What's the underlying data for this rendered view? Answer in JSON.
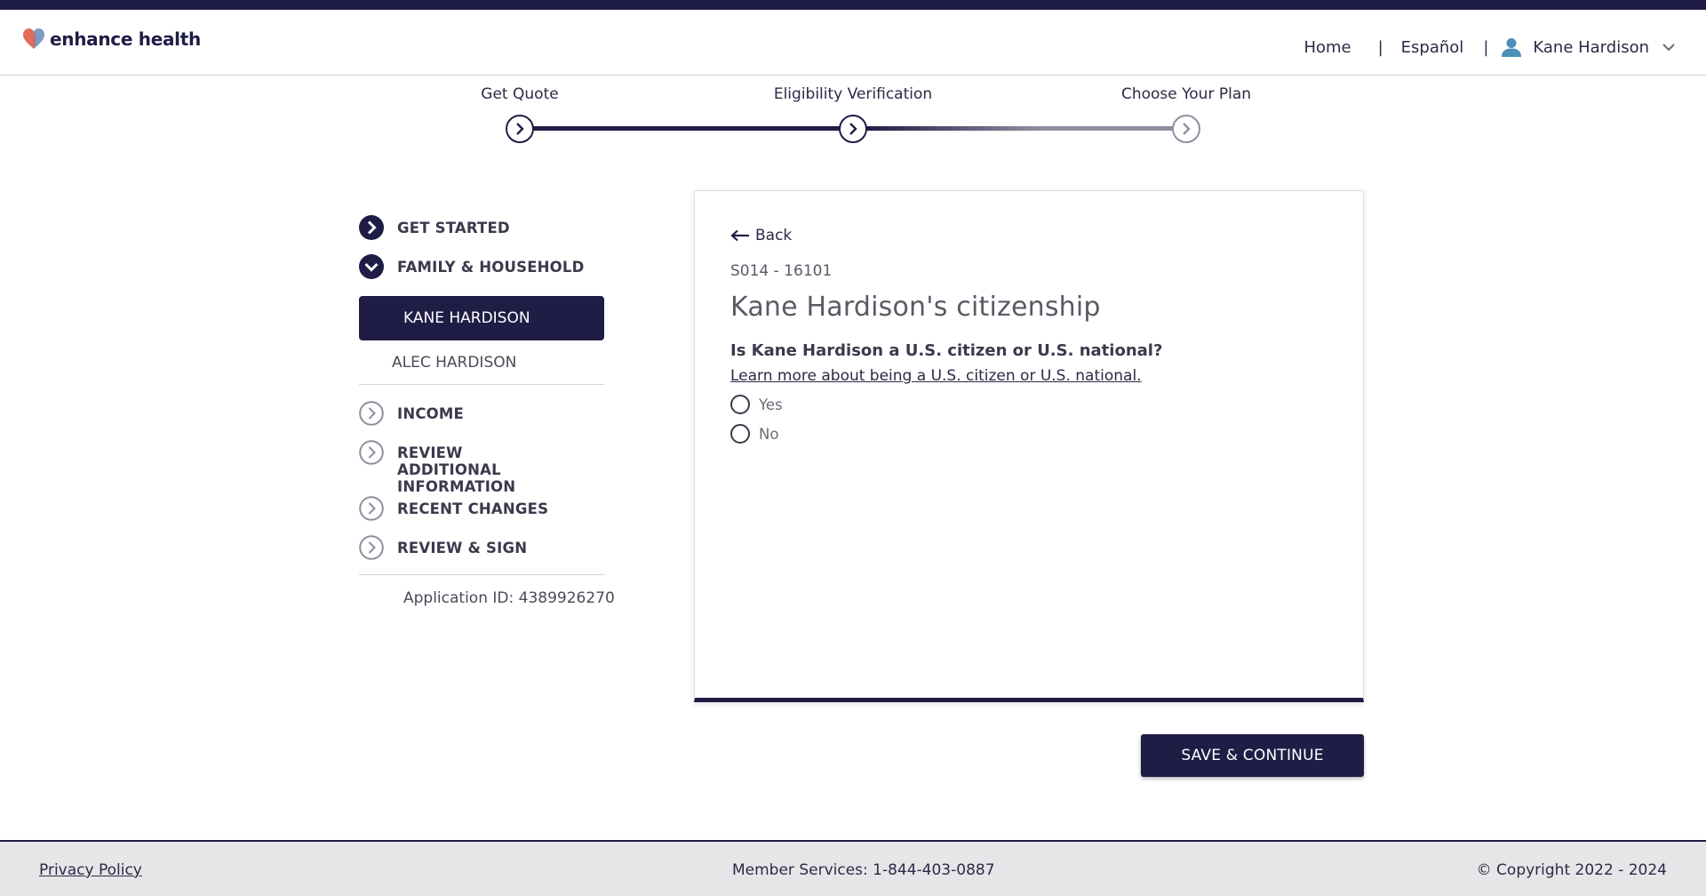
{
  "header": {
    "logo_text": "enhance health",
    "nav": {
      "home": "Home",
      "separator": "|",
      "language": "Español",
      "user_name": "Kane Hardison"
    }
  },
  "progress": {
    "steps": [
      {
        "label": "Get Quote",
        "status": "complete"
      },
      {
        "label": "Eligibility Verification",
        "status": "current"
      },
      {
        "label": "Choose Your Plan",
        "status": "upcoming"
      }
    ]
  },
  "sidebar": {
    "items": [
      {
        "label": "GET STARTED",
        "icon": "chevron-right-filled-icon"
      },
      {
        "label": "FAMILY & HOUSEHOLD",
        "icon": "chevron-down-filled-icon"
      }
    ],
    "members": [
      {
        "label": "KANE HARDISON",
        "active": true
      },
      {
        "label": "ALEC HARDISON",
        "active": false
      }
    ],
    "items2": [
      {
        "label": "INCOME"
      },
      {
        "label": "REVIEW ADDITIONAL INFORMATION"
      },
      {
        "label": "RECENT CHANGES"
      },
      {
        "label": "REVIEW & SIGN"
      }
    ],
    "application_id": "Application ID: 4389926270"
  },
  "form": {
    "back_label": "Back",
    "code": "S014 - 16101",
    "title": "Kane Hardison's citizenship",
    "question": "Is Kane Hardison a U.S. citizen or U.S. national?",
    "learn_more": "Learn more about being a U.S. citizen or U.S. national.",
    "options": [
      "Yes",
      "No"
    ],
    "save_label": "SAVE & CONTINUE"
  },
  "footer": {
    "privacy": "Privacy Policy",
    "member_services": "Member Services: 1-844-403-0887",
    "copyright": "© Copyright 2022 - 2024"
  },
  "colors": {
    "primary": "#1f1d45",
    "upcoming": "#8d8fa0",
    "logo_heart_left": "#e06b5b",
    "logo_heart_right": "#6f8fb8",
    "user_icon": "#4a90b8"
  }
}
